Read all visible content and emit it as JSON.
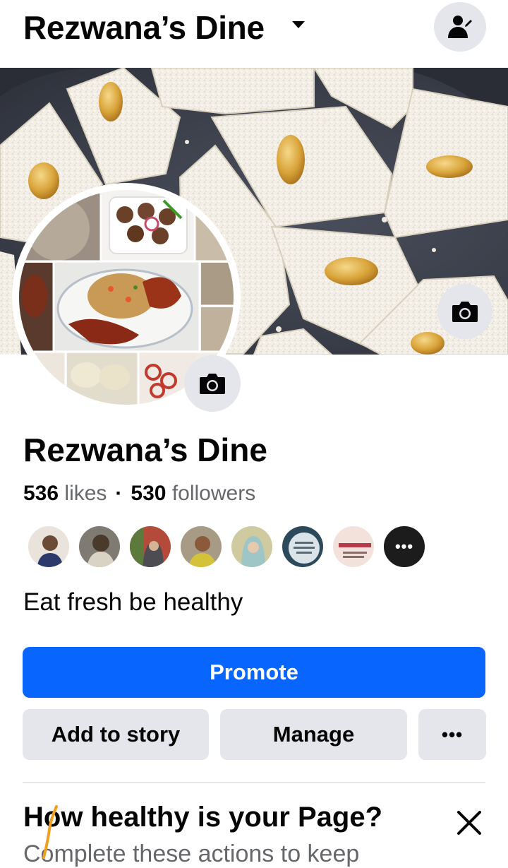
{
  "header": {
    "title": "Rezwana’s Dine",
    "dropdown_icon": "caret-down-icon",
    "edit_profile_icon": "person-edit-icon"
  },
  "cover": {
    "camera_icon": "camera-icon"
  },
  "avatar": {
    "camera_icon": "camera-icon"
  },
  "profile": {
    "name": "Rezwana’s Dine",
    "likes_count": "536",
    "likes_label": "likes",
    "separator": "·",
    "followers_count": "530",
    "followers_label": "followers",
    "bio": "Eat fresh be healthy"
  },
  "fans": {
    "more_label": "•••"
  },
  "actions": {
    "promote_label": "Promote",
    "add_story_label": "Add to story",
    "manage_label": "Manage",
    "more_label": "•••"
  },
  "health_card": {
    "title": "How healthy is your Page?",
    "subtitle": "Complete these actions to keep",
    "close_icon": "close-icon"
  },
  "colors": {
    "primary": "#0866ff",
    "button_grey": "#e4e6eb",
    "secondary_text": "#65676b"
  }
}
